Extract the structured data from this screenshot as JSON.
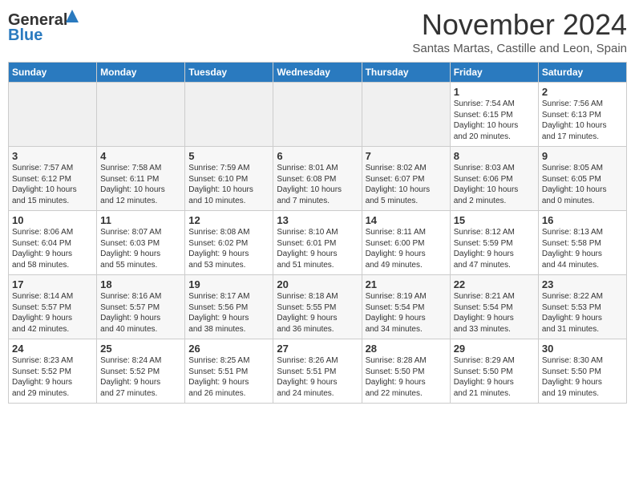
{
  "header": {
    "logo_line1": "General",
    "logo_line2": "Blue",
    "month_title": "November 2024",
    "location": "Santas Martas, Castille and Leon, Spain"
  },
  "weekdays": [
    "Sunday",
    "Monday",
    "Tuesday",
    "Wednesday",
    "Thursday",
    "Friday",
    "Saturday"
  ],
  "weeks": [
    [
      {
        "day": "",
        "info": ""
      },
      {
        "day": "",
        "info": ""
      },
      {
        "day": "",
        "info": ""
      },
      {
        "day": "",
        "info": ""
      },
      {
        "day": "",
        "info": ""
      },
      {
        "day": "1",
        "info": "Sunrise: 7:54 AM\nSunset: 6:15 PM\nDaylight: 10 hours\nand 20 minutes."
      },
      {
        "day": "2",
        "info": "Sunrise: 7:56 AM\nSunset: 6:13 PM\nDaylight: 10 hours\nand 17 minutes."
      }
    ],
    [
      {
        "day": "3",
        "info": "Sunrise: 7:57 AM\nSunset: 6:12 PM\nDaylight: 10 hours\nand 15 minutes."
      },
      {
        "day": "4",
        "info": "Sunrise: 7:58 AM\nSunset: 6:11 PM\nDaylight: 10 hours\nand 12 minutes."
      },
      {
        "day": "5",
        "info": "Sunrise: 7:59 AM\nSunset: 6:10 PM\nDaylight: 10 hours\nand 10 minutes."
      },
      {
        "day": "6",
        "info": "Sunrise: 8:01 AM\nSunset: 6:08 PM\nDaylight: 10 hours\nand 7 minutes."
      },
      {
        "day": "7",
        "info": "Sunrise: 8:02 AM\nSunset: 6:07 PM\nDaylight: 10 hours\nand 5 minutes."
      },
      {
        "day": "8",
        "info": "Sunrise: 8:03 AM\nSunset: 6:06 PM\nDaylight: 10 hours\nand 2 minutes."
      },
      {
        "day": "9",
        "info": "Sunrise: 8:05 AM\nSunset: 6:05 PM\nDaylight: 10 hours\nand 0 minutes."
      }
    ],
    [
      {
        "day": "10",
        "info": "Sunrise: 8:06 AM\nSunset: 6:04 PM\nDaylight: 9 hours\nand 58 minutes."
      },
      {
        "day": "11",
        "info": "Sunrise: 8:07 AM\nSunset: 6:03 PM\nDaylight: 9 hours\nand 55 minutes."
      },
      {
        "day": "12",
        "info": "Sunrise: 8:08 AM\nSunset: 6:02 PM\nDaylight: 9 hours\nand 53 minutes."
      },
      {
        "day": "13",
        "info": "Sunrise: 8:10 AM\nSunset: 6:01 PM\nDaylight: 9 hours\nand 51 minutes."
      },
      {
        "day": "14",
        "info": "Sunrise: 8:11 AM\nSunset: 6:00 PM\nDaylight: 9 hours\nand 49 minutes."
      },
      {
        "day": "15",
        "info": "Sunrise: 8:12 AM\nSunset: 5:59 PM\nDaylight: 9 hours\nand 47 minutes."
      },
      {
        "day": "16",
        "info": "Sunrise: 8:13 AM\nSunset: 5:58 PM\nDaylight: 9 hours\nand 44 minutes."
      }
    ],
    [
      {
        "day": "17",
        "info": "Sunrise: 8:14 AM\nSunset: 5:57 PM\nDaylight: 9 hours\nand 42 minutes."
      },
      {
        "day": "18",
        "info": "Sunrise: 8:16 AM\nSunset: 5:57 PM\nDaylight: 9 hours\nand 40 minutes."
      },
      {
        "day": "19",
        "info": "Sunrise: 8:17 AM\nSunset: 5:56 PM\nDaylight: 9 hours\nand 38 minutes."
      },
      {
        "day": "20",
        "info": "Sunrise: 8:18 AM\nSunset: 5:55 PM\nDaylight: 9 hours\nand 36 minutes."
      },
      {
        "day": "21",
        "info": "Sunrise: 8:19 AM\nSunset: 5:54 PM\nDaylight: 9 hours\nand 34 minutes."
      },
      {
        "day": "22",
        "info": "Sunrise: 8:21 AM\nSunset: 5:54 PM\nDaylight: 9 hours\nand 33 minutes."
      },
      {
        "day": "23",
        "info": "Sunrise: 8:22 AM\nSunset: 5:53 PM\nDaylight: 9 hours\nand 31 minutes."
      }
    ],
    [
      {
        "day": "24",
        "info": "Sunrise: 8:23 AM\nSunset: 5:52 PM\nDaylight: 9 hours\nand 29 minutes."
      },
      {
        "day": "25",
        "info": "Sunrise: 8:24 AM\nSunset: 5:52 PM\nDaylight: 9 hours\nand 27 minutes."
      },
      {
        "day": "26",
        "info": "Sunrise: 8:25 AM\nSunset: 5:51 PM\nDaylight: 9 hours\nand 26 minutes."
      },
      {
        "day": "27",
        "info": "Sunrise: 8:26 AM\nSunset: 5:51 PM\nDaylight: 9 hours\nand 24 minutes."
      },
      {
        "day": "28",
        "info": "Sunrise: 8:28 AM\nSunset: 5:50 PM\nDaylight: 9 hours\nand 22 minutes."
      },
      {
        "day": "29",
        "info": "Sunrise: 8:29 AM\nSunset: 5:50 PM\nDaylight: 9 hours\nand 21 minutes."
      },
      {
        "day": "30",
        "info": "Sunrise: 8:30 AM\nSunset: 5:50 PM\nDaylight: 9 hours\nand 19 minutes."
      }
    ]
  ]
}
